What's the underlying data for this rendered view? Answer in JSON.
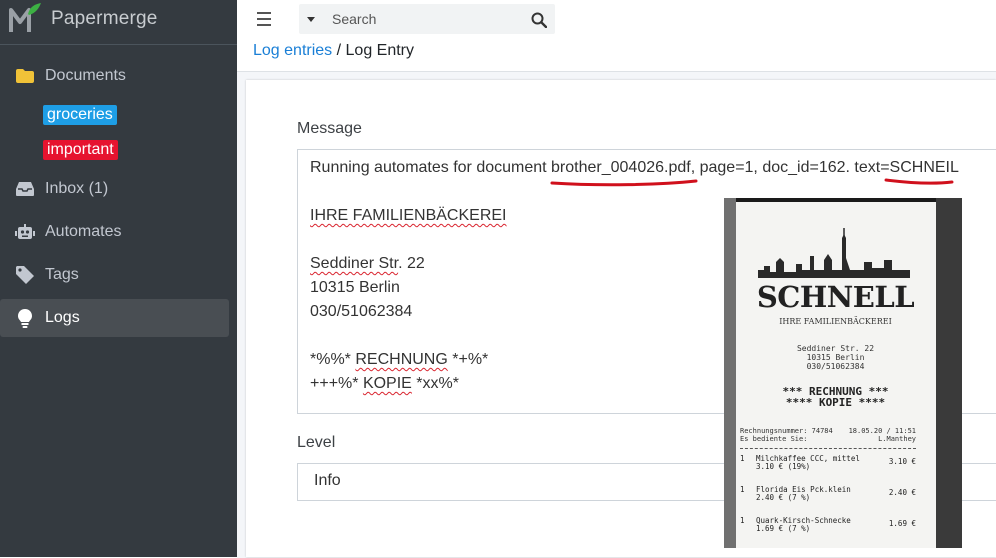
{
  "app": {
    "name": "Papermerge"
  },
  "sidebar": {
    "documents": "Documents",
    "tags": [
      "groceries",
      "important"
    ],
    "inbox": "Inbox (1)",
    "automates": "Automates",
    "tags_label": "Tags",
    "logs": "Logs"
  },
  "topbar": {
    "search_placeholder": "Search"
  },
  "breadcrumb": {
    "parent": "Log entries",
    "sep": " / ",
    "current": "Log Entry"
  },
  "form": {
    "message_label": "Message",
    "message": {
      "l1_a": "Running automates for document ",
      "l1_file": "brother_004026.pdf",
      "l1_b": ", page=1, doc_id=162. text=",
      "l1_c": "SCHNEIL",
      "l2": "IHRE FAMILIENBÄCKEREI",
      "l3_a": "Seddiner Str",
      "l3_b": ". 22",
      "l4": "10315 Berlin",
      "l5": "030/51062384",
      "l6_a": "*%%* ",
      "l6_b": "RECHNUNG",
      "l6_c": " *+%*",
      "l7_a": "+++%* ",
      "l7_b": "KOPIE",
      "l7_c": " *xx%*"
    },
    "level_label": "Level",
    "level_value": "Info"
  },
  "receipt": {
    "brand": "SCHNELL",
    "tagline": "IHRE FAMILIENBÄCKEREI",
    "addr1": "Seddiner Str. 22",
    "addr2": "10315 Berlin",
    "phone": "030/51062384",
    "rechnung": "*** RECHNUNG ***",
    "kopie": "**** KOPIE ****",
    "nr": "Rechnungsnummer: 74784",
    "date": "18.05.20 / 11:51",
    "served": "Es bediente Sie:",
    "server": "L.Manthey",
    "items": [
      {
        "qty": "1",
        "name": "Milchkaffee CCC, mittel",
        "sub": "3.10 €  (19%)",
        "price": "3.10 €"
      },
      {
        "qty": "1",
        "name": "Florida Eis Pck.klein",
        "sub": "2.40 €  (7 %)",
        "price": "2.40 €"
      },
      {
        "qty": "1",
        "name": "Quark-Kirsch-Schnecke",
        "sub": "1.69 €  (7 %)",
        "price": "1.69 €"
      }
    ]
  },
  "colors": {
    "sidebar": "#343a40",
    "link": "#1a7fd6",
    "tag_blue": "#1e9ee6",
    "tag_red": "#e6132f",
    "annotation": "#d0101c"
  }
}
